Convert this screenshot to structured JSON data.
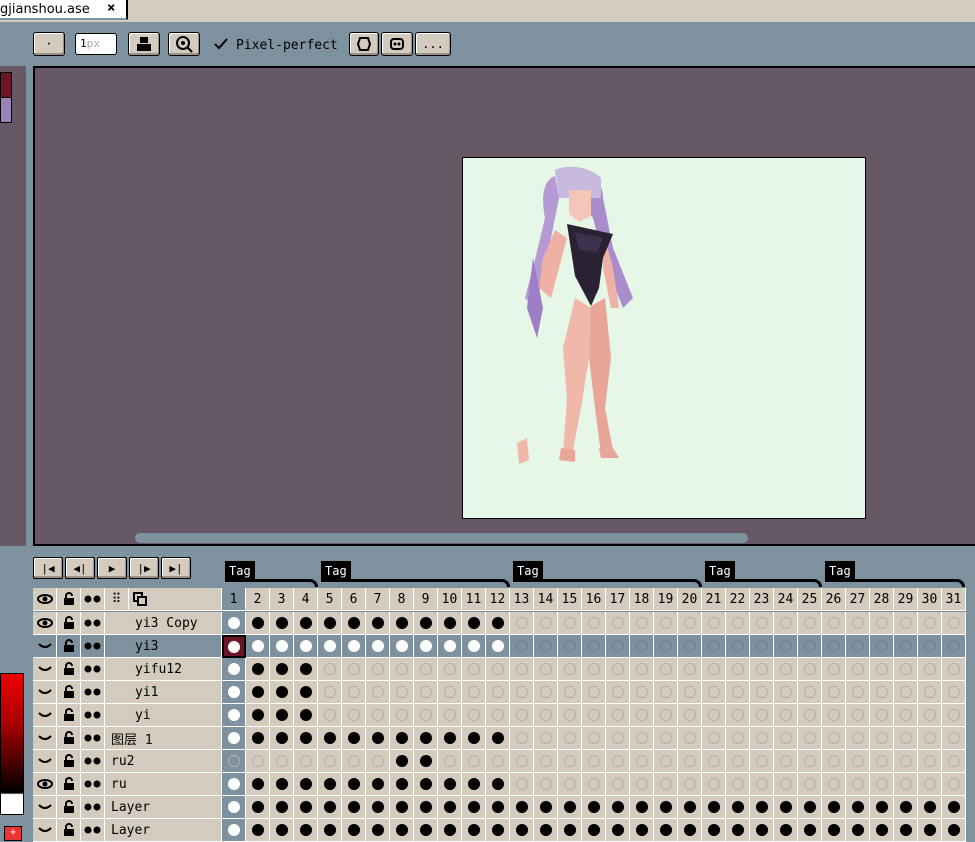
{
  "tab": {
    "title": "gjianshou.ase",
    "close_icon": "×"
  },
  "toolbar": {
    "brush_size": "1",
    "brush_unit": "px",
    "pixel_perfect_label": "Pixel-perfect",
    "more_label": "..."
  },
  "timeline": {
    "tags": [
      {
        "label": "Tag"
      },
      {
        "label": "Tag"
      },
      {
        "label": "Tag"
      },
      {
        "label": "Tag"
      },
      {
        "label": "Tag"
      }
    ],
    "frames": [
      "1",
      "2",
      "3",
      "4",
      "5",
      "6",
      "7",
      "8",
      "9",
      "10",
      "11",
      "12",
      "13",
      "14",
      "15",
      "16",
      "17",
      "18",
      "19",
      "20",
      "21",
      "22",
      "23",
      "24",
      "25",
      "26",
      "27",
      "28",
      "29",
      "30",
      "31"
    ],
    "layers": [
      {
        "name": "yi3 Copy",
        "visible": true,
        "selected": false,
        "cels": "full:1-12"
      },
      {
        "name": "yi3",
        "visible": false,
        "selected": true,
        "cels": "white:1-12"
      },
      {
        "name": "yifu12",
        "visible": false,
        "selected": false,
        "cels": "full:2-4"
      },
      {
        "name": "yi1",
        "visible": false,
        "selected": false,
        "cels": "full:2-4"
      },
      {
        "name": "yi",
        "visible": false,
        "selected": false,
        "cels": "full:2-4"
      },
      {
        "name": "图层 1",
        "visible": false,
        "selected": false,
        "cels": "full:2-12"
      },
      {
        "name": "ru2",
        "visible": false,
        "selected": false,
        "cels": "full:8-9"
      },
      {
        "name": "ru",
        "visible": true,
        "selected": false,
        "cels": "full:2-12"
      },
      {
        "name": "Layer",
        "visible": false,
        "selected": false,
        "cels": "full:2-31"
      },
      {
        "name": "Layer",
        "visible": false,
        "selected": false,
        "cels": "full:2-31"
      }
    ]
  }
}
